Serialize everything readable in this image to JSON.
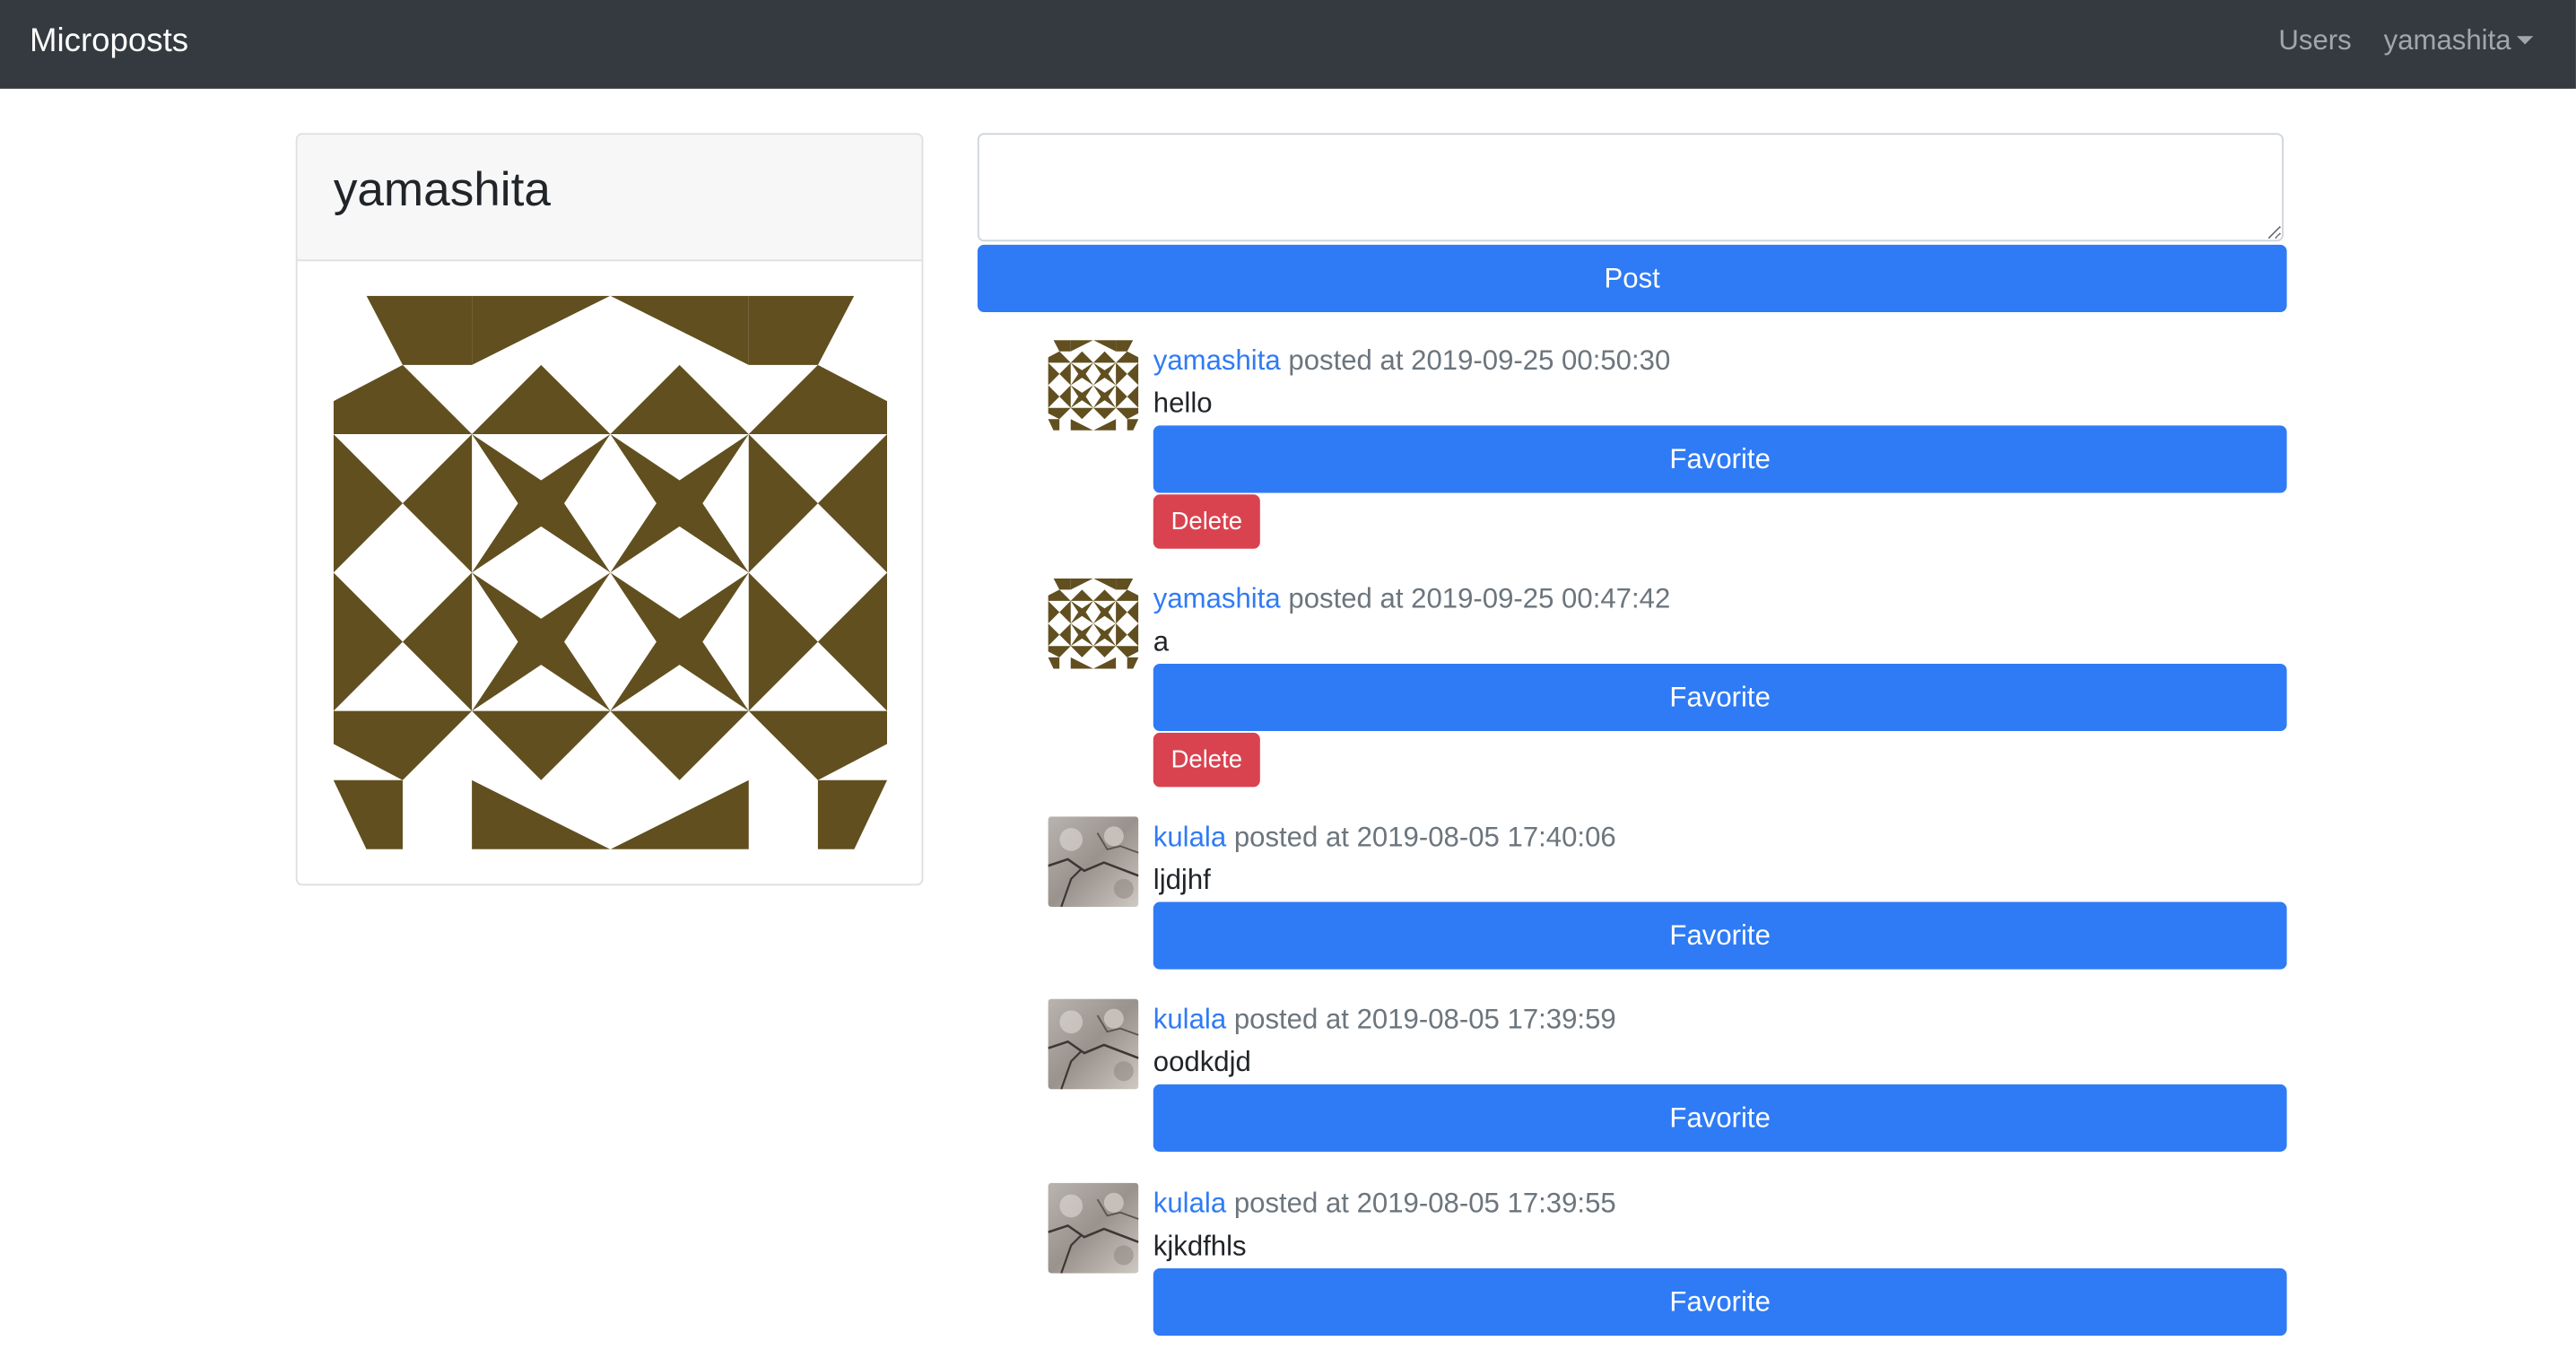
{
  "navbar": {
    "brand": "Microposts",
    "users_link": "Users",
    "user_menu": "yamashita"
  },
  "profile": {
    "name": "yamashita",
    "avatar_icon": "identicon-image",
    "avatar_color": "#614f1f"
  },
  "composer": {
    "value": "",
    "placeholder": "",
    "post_label": "Post"
  },
  "colors": {
    "navbar": "#343a40",
    "primary": "#2f7bf5",
    "danger": "#d9434f",
    "link": "#2f7bf5"
  },
  "posts": [
    {
      "user": "yamashita",
      "posted_label": "posted at 2019-09-25 00:50:30",
      "content": "hello",
      "favorite_label": "Favorite",
      "delete_label": "Delete",
      "avatar": "identicon"
    },
    {
      "user": "yamashita",
      "posted_label": "posted at 2019-09-25 00:47:42",
      "content": "a",
      "favorite_label": "Favorite",
      "delete_label": "Delete",
      "avatar": "identicon"
    },
    {
      "user": "kulala",
      "posted_label": "posted at 2019-08-05 17:40:06",
      "content": "ljdjhf",
      "favorite_label": "Favorite",
      "avatar": "photo"
    },
    {
      "user": "kulala",
      "posted_label": "posted at 2019-08-05 17:39:59",
      "content": "oodkdjd",
      "favorite_label": "Favorite",
      "avatar": "photo"
    },
    {
      "user": "kulala",
      "posted_label": "posted at 2019-08-05 17:39:55",
      "content": "kjkdfhls",
      "favorite_label": "Favorite",
      "avatar": "photo"
    }
  ]
}
